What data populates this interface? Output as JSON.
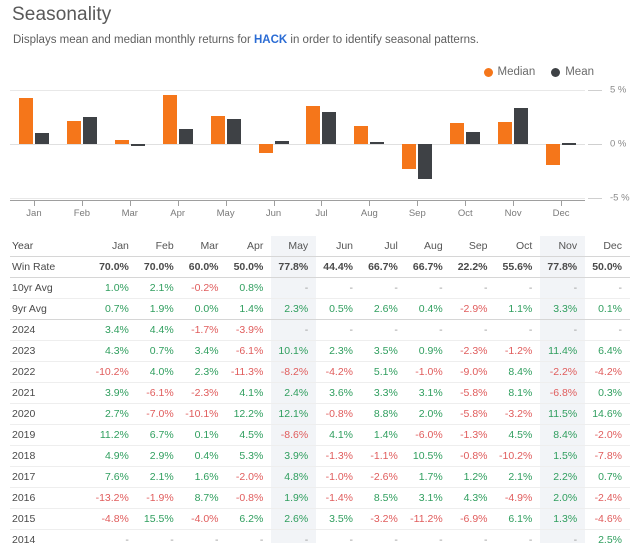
{
  "header": {
    "title": "Seasonality",
    "subtitle_before": "Displays mean and median monthly returns for ",
    "ticker": "HACK",
    "subtitle_after": " in order to identify seasonal patterns."
  },
  "legend": {
    "items": [
      {
        "label": "Median",
        "color": "#f5761a",
        "icon": "circle-dot"
      },
      {
        "label": "Mean",
        "color": "#3e4145",
        "icon": "circle-dot"
      }
    ]
  },
  "chart_data": {
    "type": "bar",
    "title": "Seasonality",
    "xlabel": "",
    "ylabel": "",
    "ylim": [
      -5,
      5
    ],
    "ytick_labels": [
      "5 %",
      "0 %",
      "-5 %"
    ],
    "yticks": [
      5,
      0,
      -5
    ],
    "grid": true,
    "legend_position": "top-right",
    "categories": [
      "Jan",
      "Feb",
      "Mar",
      "Apr",
      "May",
      "Jun",
      "Jul",
      "Aug",
      "Sep",
      "Oct",
      "Nov",
      "Dec"
    ],
    "series": [
      {
        "name": "Median",
        "color": "#f5761a",
        "values": [
          4.3,
          2.1,
          0.4,
          4.5,
          2.6,
          -0.8,
          3.5,
          1.7,
          -2.3,
          1.9,
          2.0,
          -1.9
        ]
      },
      {
        "name": "Mean",
        "color": "#3e4145",
        "values": [
          1.0,
          2.5,
          -0.2,
          1.4,
          2.3,
          0.3,
          3.0,
          0.2,
          -3.2,
          1.1,
          3.3,
          0.1
        ]
      }
    ]
  },
  "table": {
    "columns": [
      "Year",
      "Jan",
      "Feb",
      "Mar",
      "Apr",
      "May",
      "Jun",
      "Jul",
      "Aug",
      "Sep",
      "Oct",
      "Nov",
      "Dec"
    ],
    "highlighted_columns": [
      "May",
      "Nov"
    ],
    "win_rate": {
      "label": "Win Rate",
      "values": [
        "70.0%",
        "70.0%",
        "60.0%",
        "50.0%",
        "77.8%",
        "44.4%",
        "66.7%",
        "66.7%",
        "22.2%",
        "55.6%",
        "77.8%",
        "50.0%"
      ]
    },
    "rows": [
      {
        "label": "10yr Avg",
        "values": [
          "1.0%",
          "2.1%",
          "-0.2%",
          "0.8%",
          "-",
          "-",
          "-",
          "-",
          "-",
          "-",
          "-",
          "-"
        ]
      },
      {
        "label": "9yr Avg",
        "values": [
          "0.7%",
          "1.9%",
          "0.0%",
          "1.4%",
          "2.3%",
          "0.5%",
          "2.6%",
          "0.4%",
          "-2.9%",
          "1.1%",
          "3.3%",
          "0.1%"
        ]
      },
      {
        "label": "2024",
        "values": [
          "3.4%",
          "4.4%",
          "-1.7%",
          "-3.9%",
          "-",
          "-",
          "-",
          "-",
          "-",
          "-",
          "-",
          "-"
        ]
      },
      {
        "label": "2023",
        "values": [
          "4.3%",
          "0.7%",
          "3.4%",
          "-6.1%",
          "10.1%",
          "2.3%",
          "3.5%",
          "0.9%",
          "-2.3%",
          "-1.2%",
          "11.4%",
          "6.4%"
        ]
      },
      {
        "label": "2022",
        "values": [
          "-10.2%",
          "4.0%",
          "2.3%",
          "-11.3%",
          "-8.2%",
          "-4.2%",
          "5.1%",
          "-1.0%",
          "-9.0%",
          "8.4%",
          "-2.2%",
          "-4.2%"
        ]
      },
      {
        "label": "2021",
        "values": [
          "3.9%",
          "-6.1%",
          "-2.3%",
          "4.1%",
          "2.4%",
          "3.6%",
          "3.3%",
          "3.1%",
          "-5.8%",
          "8.1%",
          "-6.8%",
          "0.3%"
        ]
      },
      {
        "label": "2020",
        "values": [
          "2.7%",
          "-7.0%",
          "-10.1%",
          "12.2%",
          "12.1%",
          "-0.8%",
          "8.8%",
          "2.0%",
          "-5.8%",
          "-3.2%",
          "11.5%",
          "14.6%"
        ]
      },
      {
        "label": "2019",
        "values": [
          "11.2%",
          "6.7%",
          "0.1%",
          "4.5%",
          "-8.6%",
          "4.1%",
          "1.4%",
          "-6.0%",
          "-1.3%",
          "4.5%",
          "8.4%",
          "-2.0%"
        ]
      },
      {
        "label": "2018",
        "values": [
          "4.9%",
          "2.9%",
          "0.4%",
          "5.3%",
          "3.9%",
          "-1.3%",
          "-1.1%",
          "10.5%",
          "-0.8%",
          "-10.2%",
          "1.5%",
          "-7.8%"
        ]
      },
      {
        "label": "2017",
        "values": [
          "7.6%",
          "2.1%",
          "1.6%",
          "-2.0%",
          "4.8%",
          "-1.0%",
          "-2.6%",
          "1.7%",
          "1.2%",
          "2.1%",
          "2.2%",
          "0.7%"
        ]
      },
      {
        "label": "2016",
        "values": [
          "-13.2%",
          "-1.9%",
          "8.7%",
          "-0.8%",
          "1.9%",
          "-1.4%",
          "8.5%",
          "3.1%",
          "4.3%",
          "-4.9%",
          "2.0%",
          "-2.4%"
        ]
      },
      {
        "label": "2015",
        "values": [
          "-4.8%",
          "15.5%",
          "-4.0%",
          "6.2%",
          "2.6%",
          "3.5%",
          "-3.2%",
          "-11.2%",
          "-6.9%",
          "6.1%",
          "1.3%",
          "-4.6%"
        ]
      },
      {
        "label": "2014",
        "values": [
          "-",
          "-",
          "-",
          "-",
          "-",
          "-",
          "-",
          "-",
          "-",
          "-",
          "-",
          "2.5%"
        ]
      }
    ]
  },
  "colors": {
    "median": "#f5761a",
    "mean": "#3e4145",
    "positive": "#2f9e5e",
    "negative": "#e05c5c",
    "highlight": "#f2f4f7",
    "link": "#2b6cd4"
  }
}
